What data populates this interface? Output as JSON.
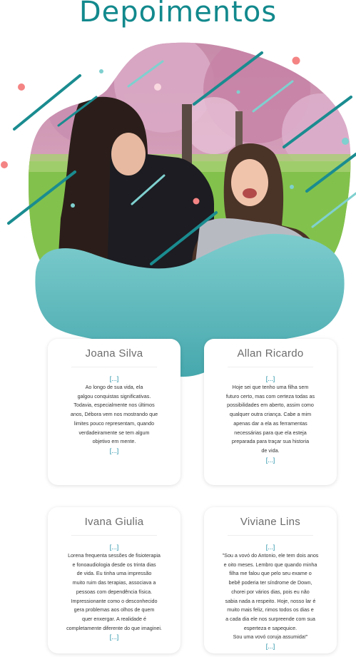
{
  "page": {
    "title": "Depoimentos"
  },
  "hero": {
    "photo": "photo-girls-laughing-in-park",
    "colors": {
      "teal": "#1a8c90",
      "light_teal": "#7fd0cf",
      "blob": "#5fbcc0",
      "pink": "#f48484",
      "grass": "#7cc34a",
      "blossom": "#d79bbb"
    }
  },
  "testimonials": [
    {
      "name": "Joana Silva",
      "open": "[...]",
      "text": "Ao longo de sua vida, ela\ngalgou conquistas significativas.\nTodavia, especialmente nos últimos\nanos, Débora vem nos mostrando que\nlimites pouco representam, quando\nverdadeiramente se tem algum\nobjetivo em mente.",
      "close": "[...]"
    },
    {
      "name": "Allan Ricardo",
      "open": "[...]",
      "text": "Hoje sei que tenho uma filha sem\nfuturo certo, mas com certeza todas as\npossibilidades em aberto, assim como\nqualquer outra criança. Cabe a mim\napenas dar a ela as ferramentas\nnecessárias para que ela esteja\npreparada para traçar sua historia\nde vida.",
      "close": "[...]"
    },
    {
      "name": "Ivana Giulia",
      "open": "[...]",
      "text": "Lorena frequenta sessões de fisioterapia\ne fonoaudiologia desde os trinta dias\nde vida. Eu tinha uma impressão\nmuito ruim das terapias, associava a\npessoas com dependência física.\nImpressionante como o desconhecido\ngera problemas aos olhos de quem\nquer enxergar. A realidade é\ncompletamente diferente do que imaginei.",
      "close": "[...]"
    },
    {
      "name": "Viviane Lins",
      "open": "[...]",
      "text": "\"Sou a vovó do Antonio, ele tem dois anos\ne oito meses. Lembro que quando minha\nfilha me falou que pelo seu exame o\nbebê poderia ter síndrome de Down,\nchorei por vários dias, pois eu não\nsabia nada a respeito. Hoje, nosso lar é\nmuito mais feliz, rimos todos os dias e\na cada dia ele nos surpreende com sua\nesperteza e sapequice.\nSou uma vovó coruja assumida!\"",
      "close": "[...]"
    }
  ]
}
